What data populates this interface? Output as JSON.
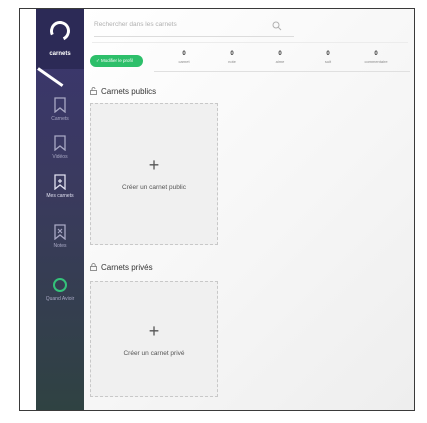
{
  "sidebar": {
    "logo_text": "carnets",
    "items": [
      {
        "label": "Carnets",
        "icon": "bookmark-icon"
      },
      {
        "label": "Vidéos",
        "icon": "bookmark-icon"
      },
      {
        "label": "Mes carnets",
        "icon": "bookmark-edit-icon"
      },
      {
        "label": "Notes",
        "icon": "bookmark-x-icon"
      },
      {
        "label": "Quand Avioir",
        "icon": "circle-icon"
      }
    ]
  },
  "search": {
    "placeholder": "Rechercher dans les carnets"
  },
  "profile": {
    "button_label": "✓ Modifier le profil",
    "stats": [
      {
        "value": "0",
        "label": "carnet"
      },
      {
        "value": "0",
        "label": "note"
      },
      {
        "value": "0",
        "label": "aime"
      },
      {
        "value": "0",
        "label": "suit"
      },
      {
        "value": "0",
        "label": "commentaire"
      }
    ]
  },
  "sections": {
    "public": {
      "title": "Carnets publics",
      "create_label": "Créer un carnet public"
    },
    "private": {
      "title": "Carnets privés",
      "create_label": "Créer un carnet privé"
    }
  },
  "colors": {
    "sidebar": "#3b3570",
    "accent": "#2dbf6a"
  }
}
